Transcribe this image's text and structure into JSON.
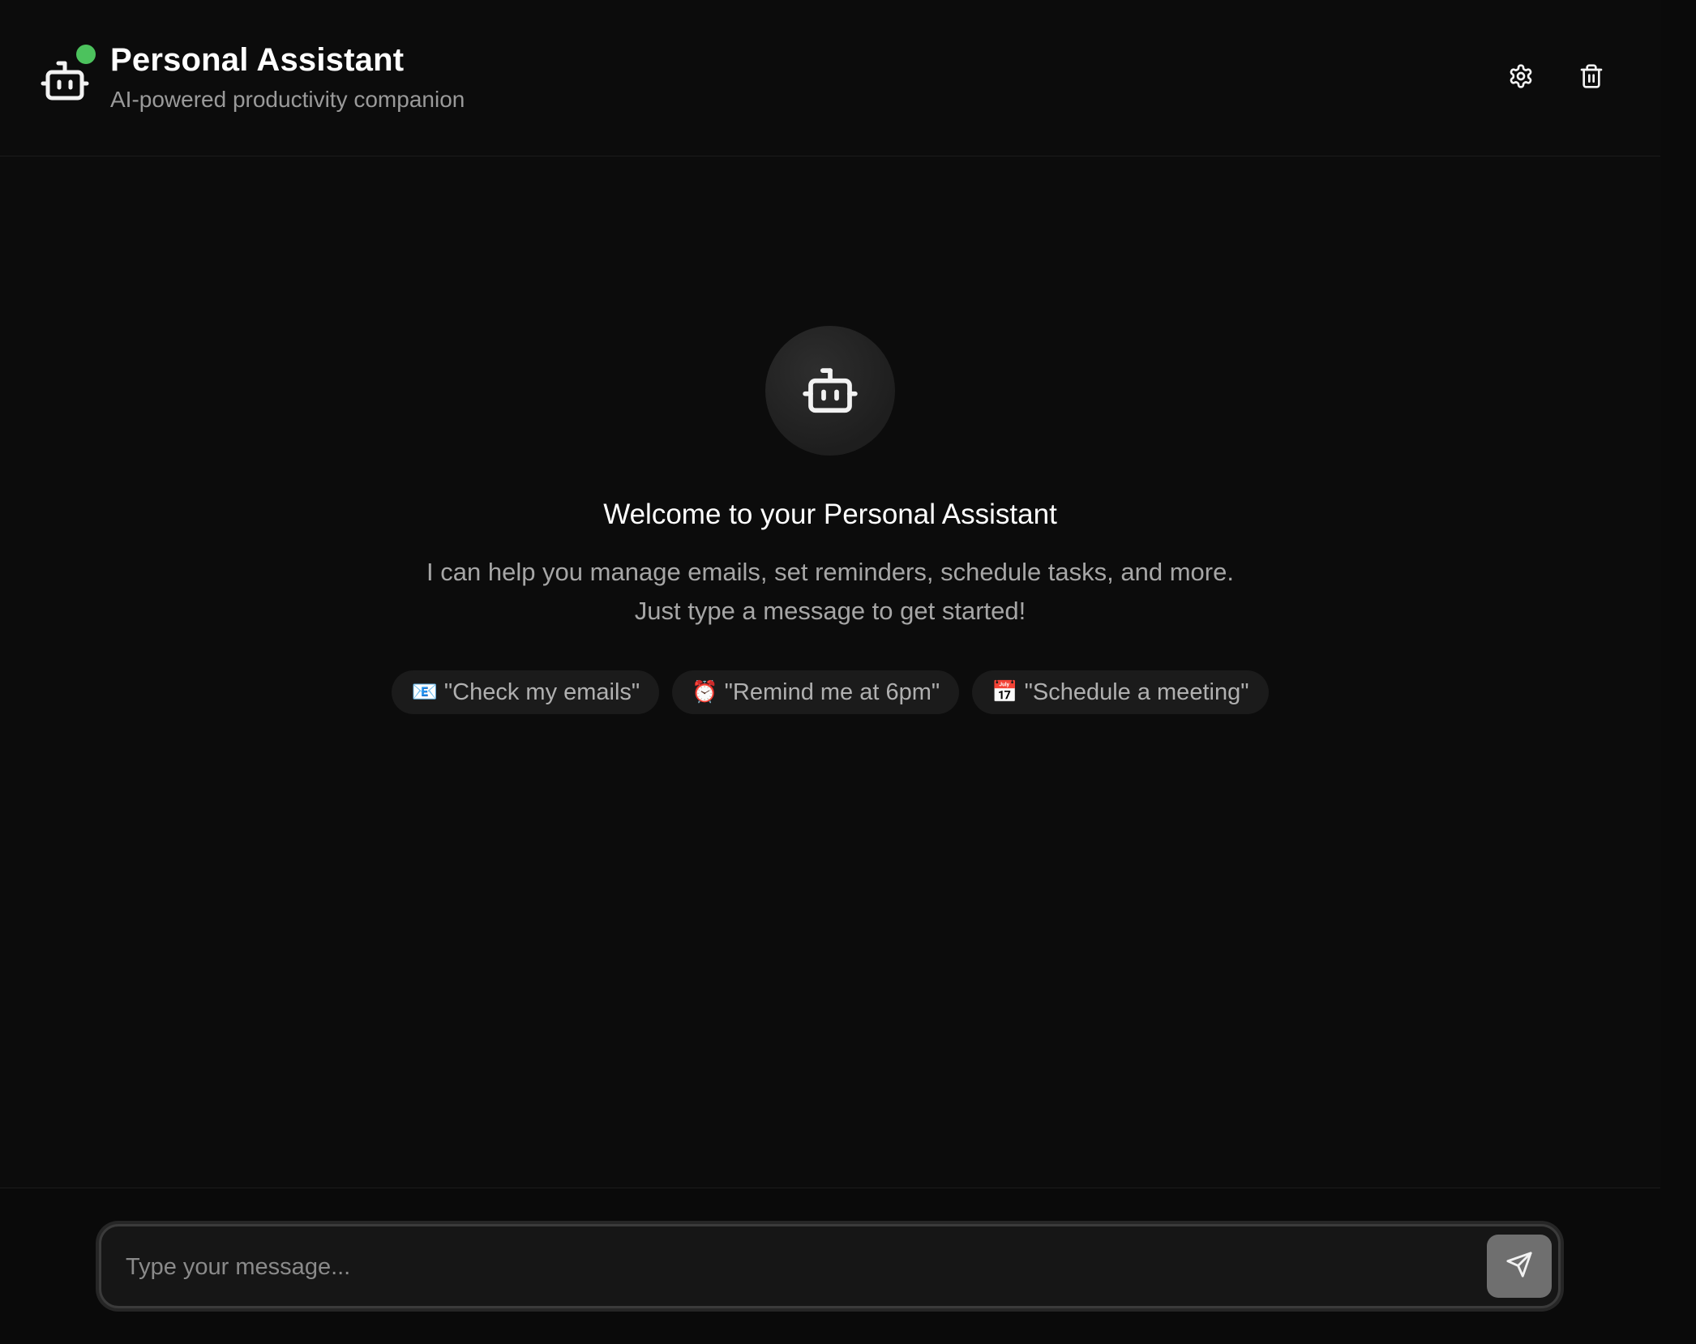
{
  "header": {
    "title": "Personal Assistant",
    "subtitle": "AI-powered productivity companion",
    "status": "online",
    "status_color": "#4cc25d",
    "icons": [
      "bot-icon",
      "gear-icon",
      "trash-icon"
    ]
  },
  "welcome": {
    "title": "Welcome to your Personal Assistant",
    "text": "I can help you manage emails, set reminders, schedule tasks, and more. Just type a message to get started!",
    "suggestions": [
      {
        "emoji": "📧",
        "label": "\"Check my emails\""
      },
      {
        "emoji": "⏰",
        "label": "\"Remind me at 6pm\""
      },
      {
        "emoji": "📅",
        "label": "\"Schedule a meeting\""
      }
    ]
  },
  "composer": {
    "placeholder": "Type your message...",
    "value": "",
    "send_icon": "send-icon"
  },
  "colors": {
    "background": "#0c0c0c",
    "accent_online": "#4cc25d",
    "send_button": "#6f6f6f"
  }
}
